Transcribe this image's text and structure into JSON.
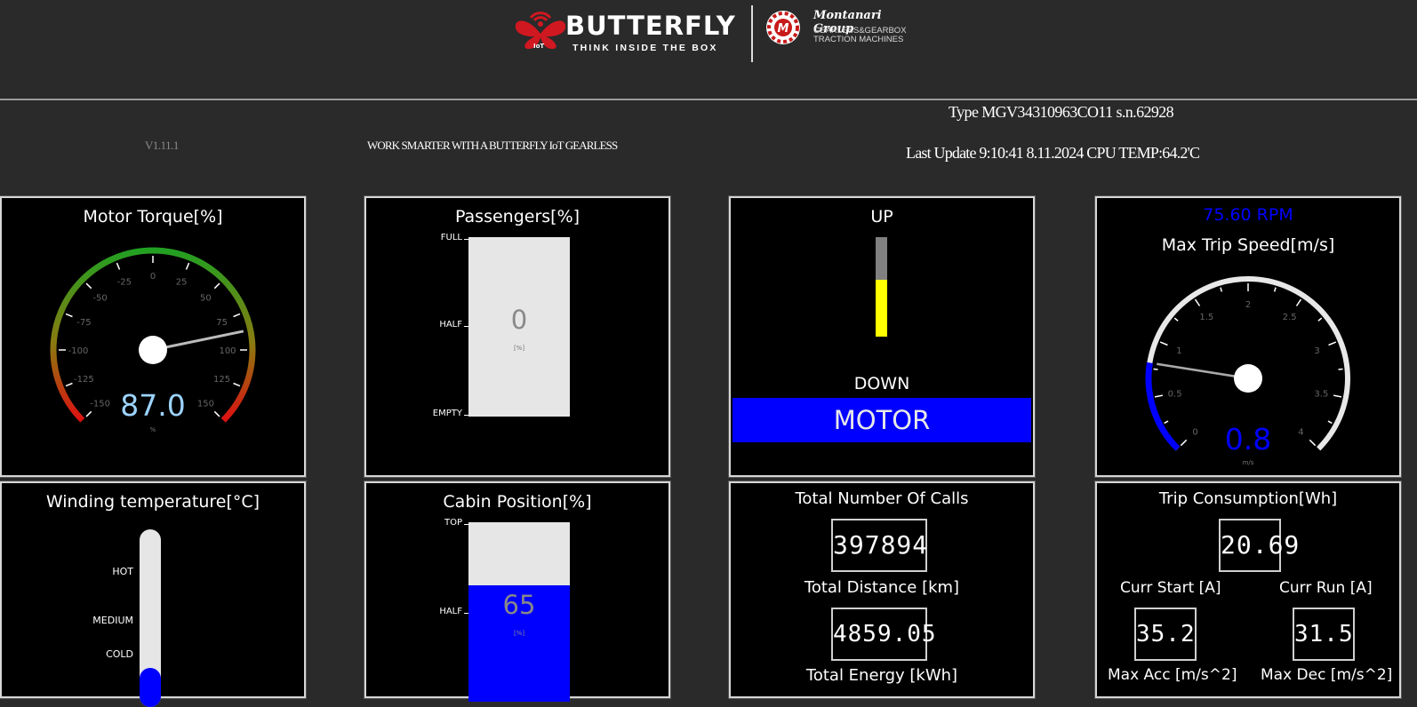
{
  "header": {
    "brand_title": "BUTTERFLY",
    "brand_tagline": "THINK INSIDE THE BOX",
    "brand_badge": "IoT",
    "partner_name": "Montanari Group",
    "partner_line1": "GEARLESS&GEARBOX",
    "partner_line2": "TRACTION MACHINES"
  },
  "info": {
    "version": "V1.11.1",
    "tagline": "WORK SMARTER WITH A BUTTERFLY IoT GEARLESS",
    "type_line": "Type MGV34310963CO11 s.n.62928",
    "update_line": "Last Update 9:10:41 8.11.2024 CPU TEMP:64.2'C"
  },
  "torque": {
    "title": "Motor Torque[%]",
    "value": "87.0",
    "unit": "%",
    "ticks": [
      "-150",
      "-125",
      "-100",
      "-75",
      "-50",
      "-25",
      "0",
      "25",
      "50",
      "75",
      "100",
      "125",
      "150"
    ],
    "needle_value": 87
  },
  "passengers": {
    "title": "Passengers[%]",
    "value": "0",
    "unit": "[%]",
    "fill": 0,
    "labels": [
      "FULL",
      "HALF",
      "EMPTY"
    ]
  },
  "direction": {
    "up_label": "UP",
    "down_label": "DOWN",
    "mode": "MOTOR",
    "fill": 0.57
  },
  "speed": {
    "title": "Max Trip Speed[m/s]",
    "rpm": "75.60 RPM",
    "value": "0.8",
    "unit": "m/s",
    "ticks": [
      "0",
      "0.5",
      "1",
      "1.5",
      "2",
      "2.5",
      "3",
      "3.5",
      "4"
    ],
    "needle_value": 0.8
  },
  "winding": {
    "title": "Winding temperature[°C]",
    "labels": [
      "HOT",
      "MEDIUM",
      "COLD"
    ],
    "fill": 0.22
  },
  "cabin": {
    "title": "Cabin Position[%]",
    "value": "65",
    "unit": "[%]",
    "fill": 0.65,
    "labels": [
      "TOP",
      "HALF"
    ]
  },
  "counters": {
    "calls_label": "Total Number Of Calls",
    "calls_value": "397894",
    "distance_label": "Total Distance [km]",
    "distance_value": "4859.05",
    "energy_label": "Total Energy [kWh]"
  },
  "consumption": {
    "title": "Trip Consumption[Wh]",
    "value": "20.69",
    "curr_start_label": "Curr Start [A]",
    "curr_start_value": "35.2",
    "curr_run_label": "Curr Run [A]",
    "curr_run_value": "31.5",
    "max_acc_label": "Max Acc [m/s^2]",
    "max_dec_label": "Max Dec [m/s^2]"
  },
  "colors": {
    "accent_blue": "#0000ff",
    "gauge_green": "#22a022",
    "gauge_red": "#dd1111",
    "direction_yellow": "#ffff00",
    "value_lightblue": "#9cd3ff"
  }
}
